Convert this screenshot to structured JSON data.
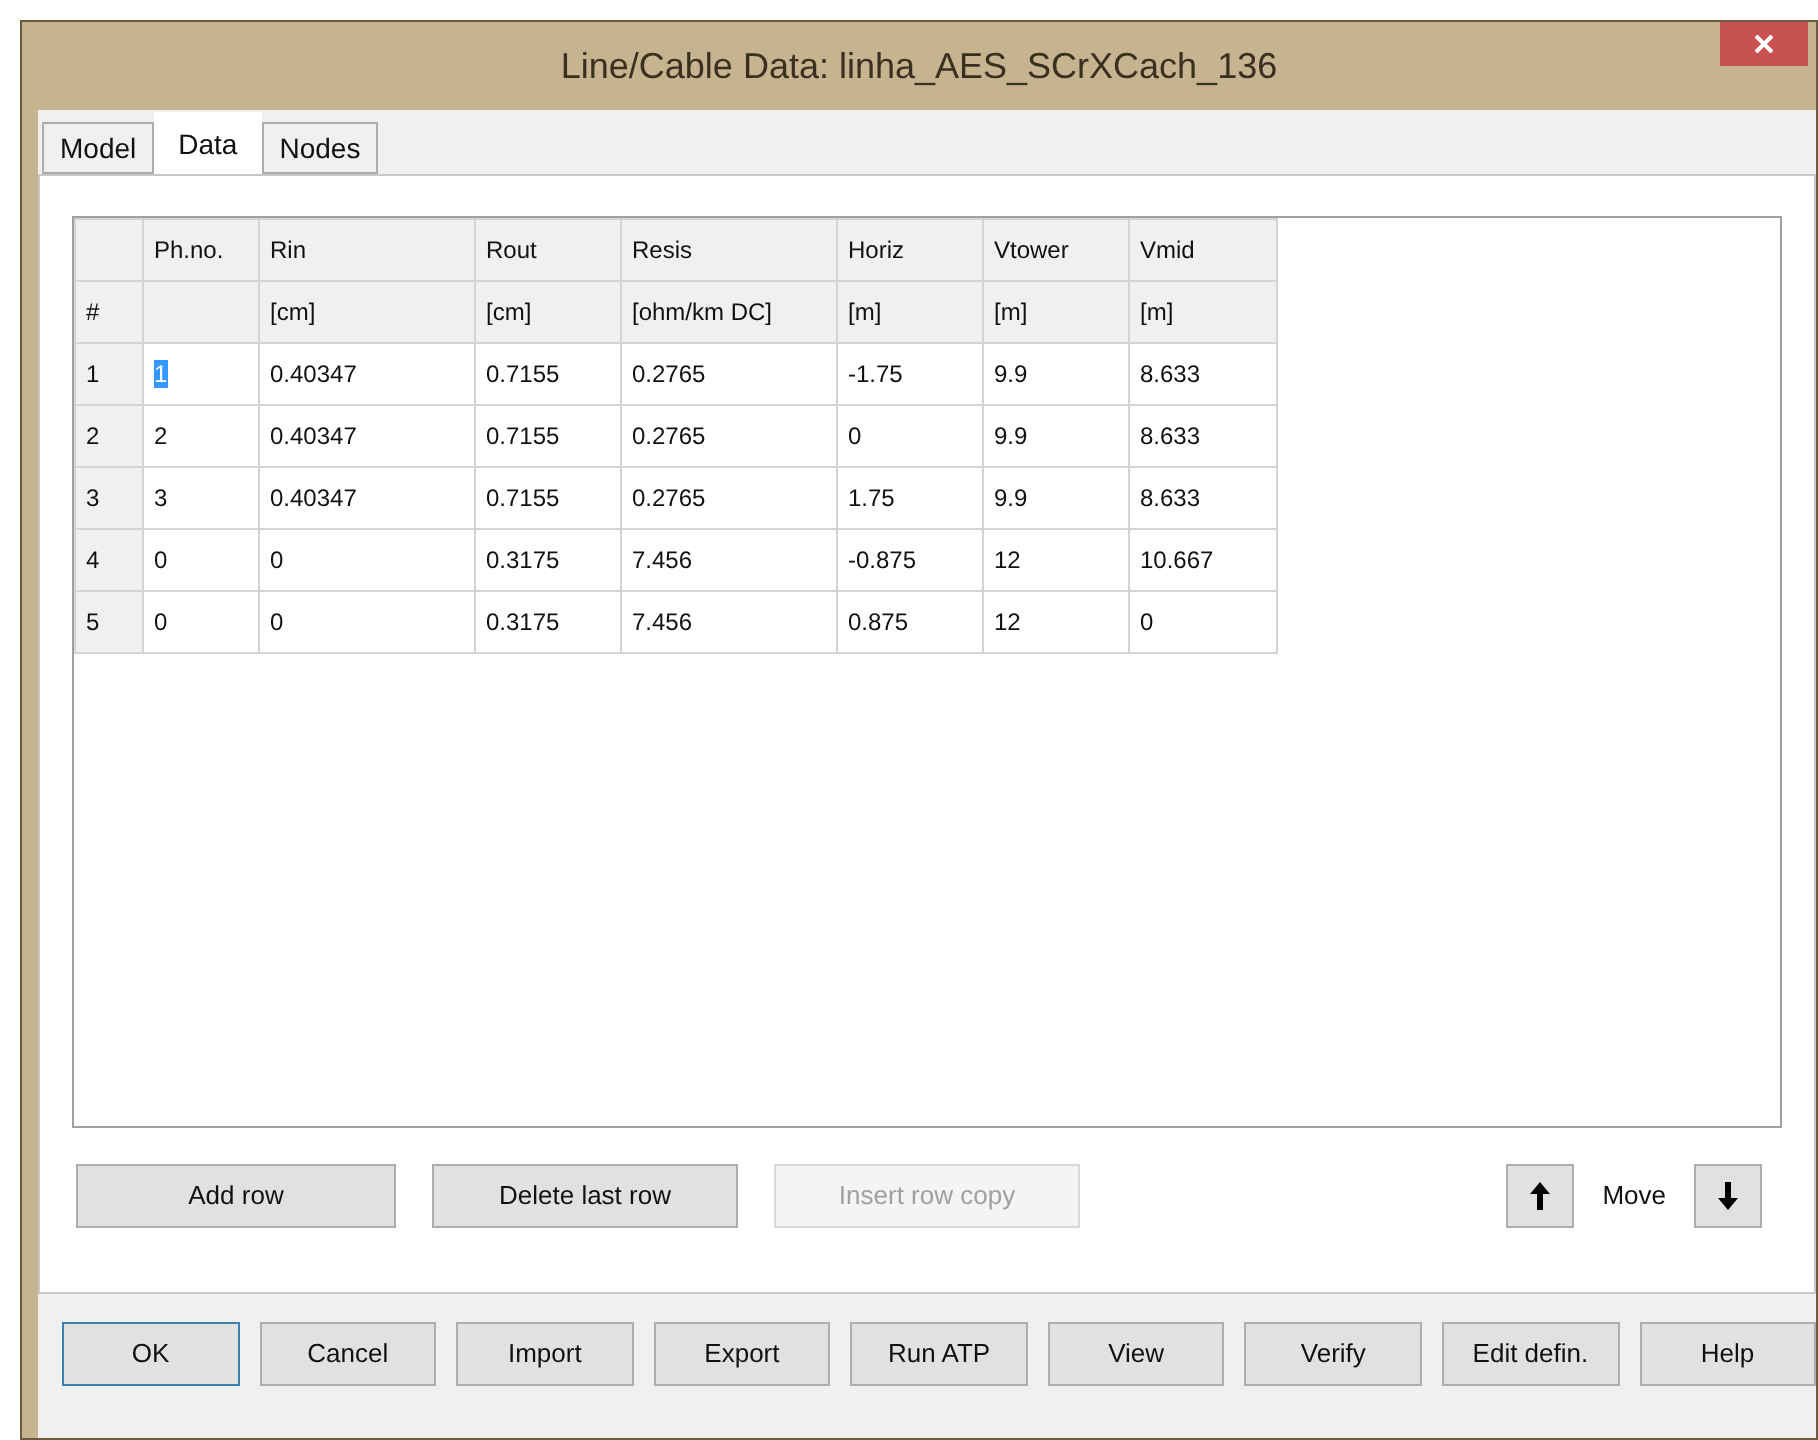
{
  "window": {
    "title": "Line/Cable Data: linha_AES_SCrXCach_136"
  },
  "tabs": [
    {
      "label": "Model",
      "selected": false
    },
    {
      "label": "Data",
      "selected": true
    },
    {
      "label": "Nodes",
      "selected": false
    }
  ],
  "table": {
    "columns": [
      {
        "unit": "#"
      },
      {
        "name": "Ph.no."
      },
      {
        "name": "Rin",
        "unit": "[cm]"
      },
      {
        "name": "Rout",
        "unit": "[cm]"
      },
      {
        "name": "Resis",
        "unit": "[ohm/km DC]"
      },
      {
        "name": "Horiz",
        "unit": "[m]"
      },
      {
        "name": "Vtower",
        "unit": "[m]"
      },
      {
        "name": "Vmid",
        "unit": "[m]"
      }
    ],
    "rows": [
      {
        "cells": [
          "1",
          "1",
          "0.40347",
          "0.7155",
          "0.2765",
          "-1.75",
          "9.9",
          "8.633"
        ],
        "selected": true
      },
      {
        "cells": [
          "2",
          "2",
          "0.40347",
          "0.7155",
          "0.2765",
          "0",
          "9.9",
          "8.633"
        ],
        "selected": false
      },
      {
        "cells": [
          "3",
          "3",
          "0.40347",
          "0.7155",
          "0.2765",
          "1.75",
          "9.9",
          "8.633"
        ],
        "selected": false
      },
      {
        "cells": [
          "4",
          "0",
          "0",
          "0.3175",
          "7.456",
          "-0.875",
          "12",
          "10.667"
        ],
        "selected": false
      },
      {
        "cells": [
          "5",
          "0",
          "0",
          "0.3175",
          "7.456",
          "0.875",
          "12",
          "0"
        ],
        "selected": false
      }
    ]
  },
  "row_buttons": [
    {
      "label": "Add row",
      "disabled": false
    },
    {
      "label": "Delete last row",
      "disabled": false
    },
    {
      "label": "Insert row copy",
      "disabled": true
    }
  ],
  "move": {
    "label": "Move"
  },
  "buttons": [
    {
      "label": "OK",
      "default": true
    },
    {
      "label": "Cancel",
      "default": false
    },
    {
      "label": "Import",
      "default": false
    },
    {
      "label": "Export",
      "default": false
    },
    {
      "label": "Run ATP",
      "default": false
    },
    {
      "label": "View",
      "default": false
    },
    {
      "label": "Verify",
      "default": false
    },
    {
      "label": "Edit defin.",
      "default": false
    },
    {
      "label": "Help",
      "default": false
    }
  ]
}
